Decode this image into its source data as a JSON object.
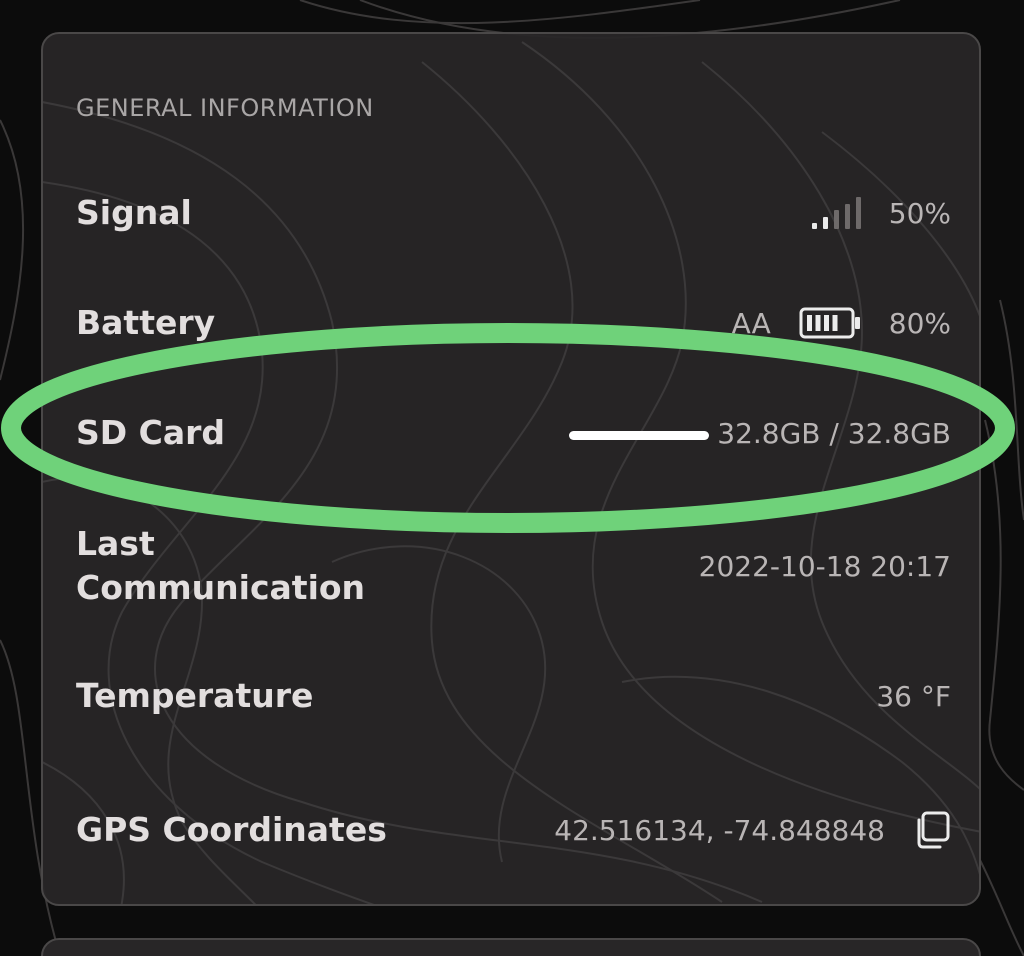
{
  "section": {
    "title": "GENERAL INFORMATION"
  },
  "rows": {
    "signal": {
      "label": "Signal",
      "value": "50%",
      "bars_total": 5,
      "bars_active": 2
    },
    "battery": {
      "label": "Battery",
      "type": "AA",
      "value": "80%",
      "level": 0.8
    },
    "sd_card": {
      "label": "SD Card",
      "value": "32.8GB / 32.8GB"
    },
    "last_communication": {
      "label": "Last\nCommunication",
      "value": "2022-10-18 20:17"
    },
    "temperature": {
      "label": "Temperature",
      "value": "36 °F"
    },
    "gps": {
      "label": "GPS Coordinates",
      "value": "42.516134, -74.848848"
    }
  },
  "icons": {
    "signal": "signal-strength-icon",
    "battery": "battery-icon",
    "copy": "copy-icon"
  },
  "colors": {
    "background": "#0c0c0c",
    "card": "#282627",
    "highlight": "#6fd27a"
  }
}
